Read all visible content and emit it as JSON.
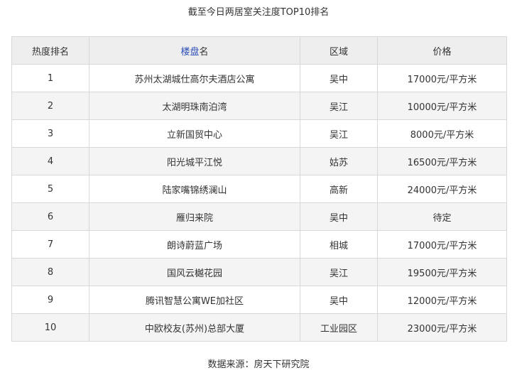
{
  "title": "截至今日两居室关注度TOP10排名",
  "table": {
    "headers": {
      "rank": "热度排名",
      "name_link": "楼盘",
      "name_rest": "名",
      "area": "区域",
      "price": "价格"
    },
    "rows": [
      {
        "rank": "1",
        "name": "苏州太湖城仕高尔夫酒店公寓",
        "area": "吴中",
        "price": "17000元/平方米"
      },
      {
        "rank": "2",
        "name": "太湖明珠南泊湾",
        "area": "吴江",
        "price": "10000元/平方米"
      },
      {
        "rank": "3",
        "name": "立新国贸中心",
        "area": "吴江",
        "price": "8000元/平方米"
      },
      {
        "rank": "4",
        "name": "阳光城平江悦",
        "area": "姑苏",
        "price": "16500元/平方米"
      },
      {
        "rank": "5",
        "name": "陆家嘴锦绣澜山",
        "area": "高新",
        "price": "24000元/平方米"
      },
      {
        "rank": "6",
        "name": "雁归来院",
        "area": "吴中",
        "price": "待定"
      },
      {
        "rank": "7",
        "name": "朗诗蔚蓝广场",
        "area": "相城",
        "price": "17000元/平方米"
      },
      {
        "rank": "8",
        "name": "国风云樾花园",
        "area": "吴江",
        "price": "19500元/平方米"
      },
      {
        "rank": "9",
        "name": "腾讯智慧公寓WE加社区",
        "area": "吴中",
        "price": "12000元/平方米"
      },
      {
        "rank": "10",
        "name": "中欧校友(苏州)总部大厦",
        "area": "工业园区",
        "price": "23000元/平方米"
      }
    ]
  },
  "source": "数据来源：房天下研究院",
  "colors": {
    "link": "#2a4fb8",
    "header_bg": "#eeeeee",
    "stripe_bg": "#f4f4f4",
    "border": "#d8d8d8"
  }
}
